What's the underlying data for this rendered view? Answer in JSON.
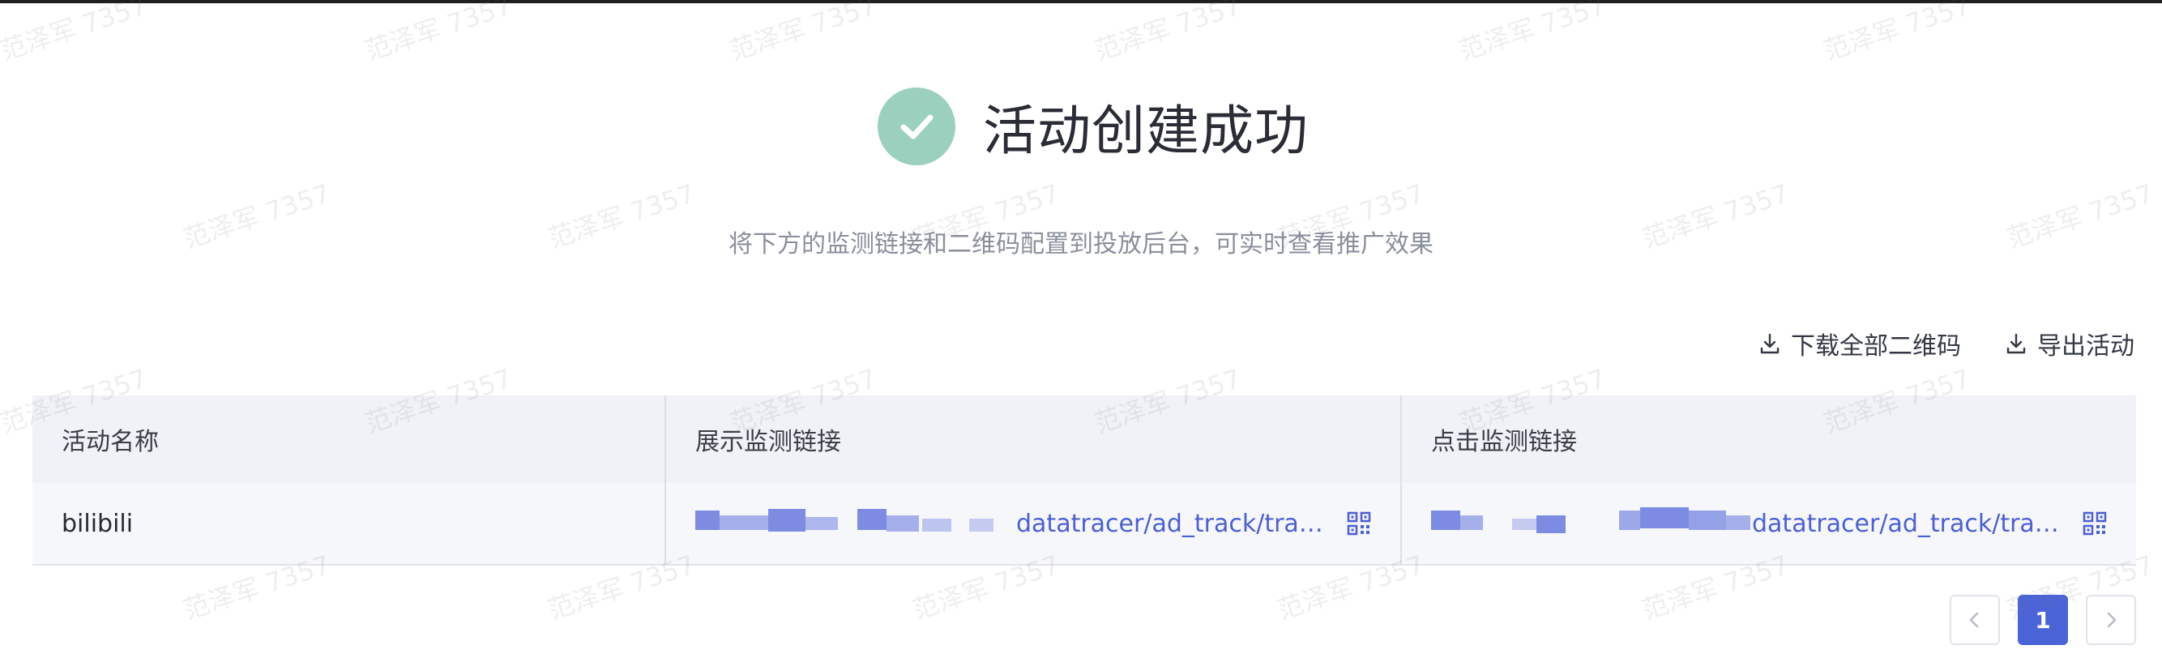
{
  "success": {
    "title": "活动创建成功",
    "subtitle": "将下方的监测链接和二维码配置到投放后台，可实时查看推广效果",
    "icon": "check-circle-icon",
    "icon_color": "#9bd0be"
  },
  "actions": {
    "download_qr_label": "下载全部二维码",
    "export_label": "导出活动",
    "icon": "download-icon"
  },
  "table": {
    "headers": [
      "活动名称",
      "展示监测链接",
      "点击监测链接"
    ],
    "rows": [
      {
        "name": "bilibili",
        "impression_link_visible": "datatracer/ad_track/tra…",
        "click_link_visible": "datatracer/ad_track/tra…"
      }
    ],
    "qr_icon": "qrcode-icon"
  },
  "pagination": {
    "prev_icon": "chevron-left-icon",
    "current_page": "1",
    "next_icon": "chevron-right-icon"
  },
  "watermark": "范泽军 7357",
  "colors": {
    "accent": "#4a63d7",
    "link": "#4b5fd6",
    "success": "#9bd0be"
  }
}
